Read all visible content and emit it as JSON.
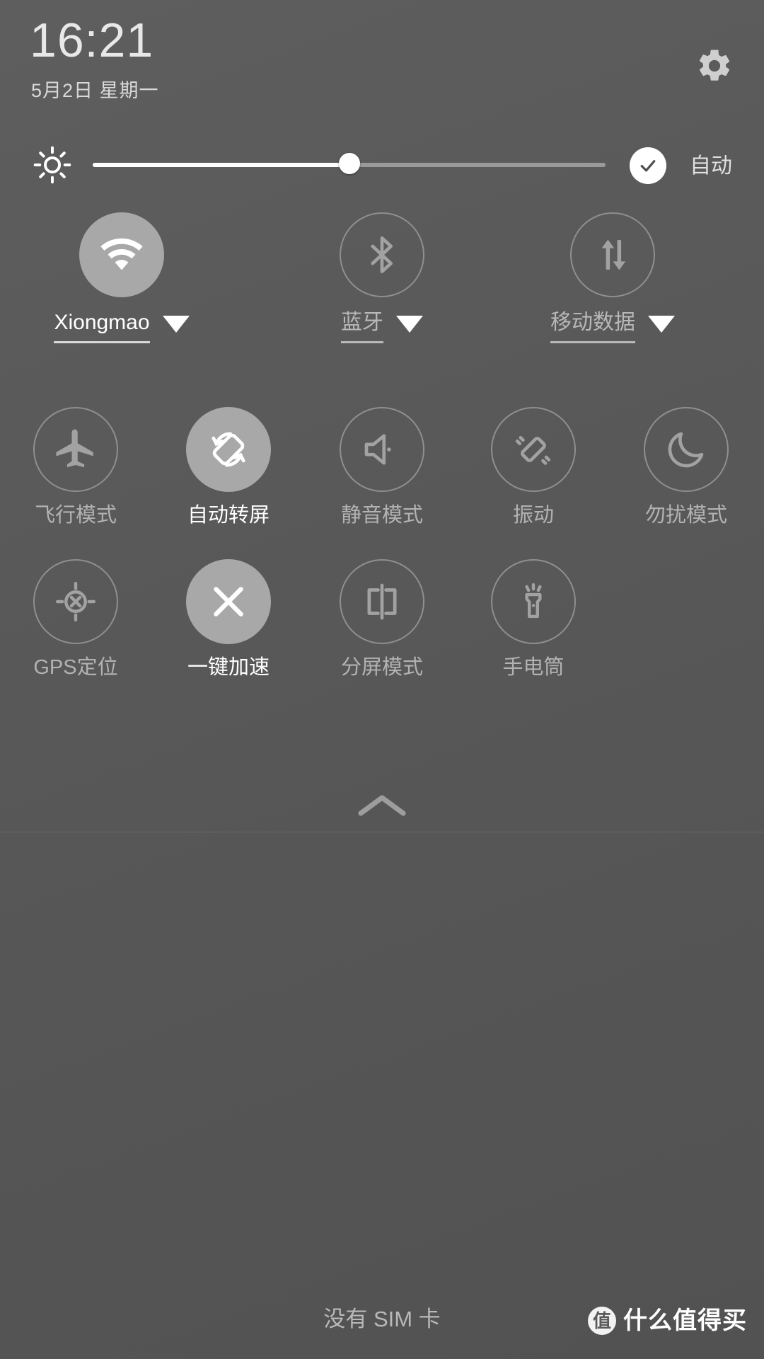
{
  "header": {
    "time": "16:21",
    "date": "5月2日 星期一",
    "settings_icon": "gear-icon"
  },
  "brightness": {
    "icon": "brightness-sun-icon",
    "value_percent": 50,
    "auto_label": "自动",
    "auto_enabled": true,
    "check_icon": "check-icon"
  },
  "connectivity_tiles": [
    {
      "id": "wifi",
      "label": "Xiongmao",
      "icon": "wifi-icon",
      "active": true,
      "has_caret": true
    },
    {
      "id": "bluetooth",
      "label": "蓝牙",
      "icon": "bluetooth-icon",
      "active": false,
      "has_caret": true
    },
    {
      "id": "mobile-data",
      "label": "移动数据",
      "icon": "mobile-data-icon",
      "active": false,
      "has_caret": true
    }
  ],
  "toggle_row_2": [
    {
      "id": "airplane-mode",
      "label": "飞行模式",
      "icon": "airplane-icon",
      "active": false
    },
    {
      "id": "auto-rotate",
      "label": "自动转屏",
      "icon": "auto-rotate-icon",
      "active": true
    },
    {
      "id": "silent-mode",
      "label": "静音模式",
      "icon": "mute-icon",
      "active": false
    },
    {
      "id": "vibrate",
      "label": "振动",
      "icon": "vibrate-icon",
      "active": false
    },
    {
      "id": "do-not-disturb",
      "label": "勿扰模式",
      "icon": "moon-icon",
      "active": false
    }
  ],
  "toggle_row_3": [
    {
      "id": "gps",
      "label": "GPS定位",
      "icon": "gps-icon",
      "active": false
    },
    {
      "id": "boost",
      "label": "一键加速",
      "icon": "close-x-icon",
      "active": true
    },
    {
      "id": "split-screen",
      "label": "分屏模式",
      "icon": "split-screen-icon",
      "active": false
    },
    {
      "id": "flashlight",
      "label": "手电筒",
      "icon": "flashlight-icon",
      "active": false
    }
  ],
  "collapse": {
    "icon": "chevron-up-icon"
  },
  "footer": {
    "sim_status": "没有 SIM 卡",
    "watermark_logo": "值",
    "watermark_text": "什么值得买"
  },
  "colors": {
    "panel_background": "#585858",
    "tile_active": "#a8a8a8",
    "tile_outline": "#8f8f8f",
    "text_primary": "#ffffff",
    "text_secondary": "#b2b2b2",
    "slider_fill": "#ffffff",
    "slider_track": "#9a9a9a"
  }
}
